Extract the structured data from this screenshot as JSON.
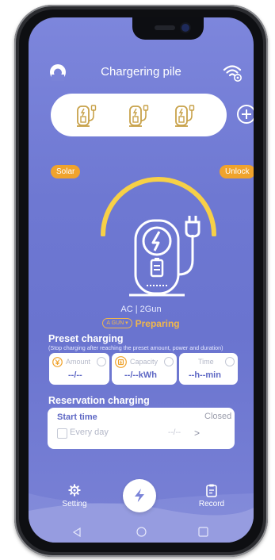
{
  "header": {
    "title": "Chargering pile"
  },
  "badges": {
    "solar": "Solar",
    "unlock": "Unlock"
  },
  "charger": {
    "spec": "AC | 2Gun",
    "gun_select": "A GUN",
    "status": "Preparing"
  },
  "preset": {
    "title": "Preset charging",
    "note": "(Stop charging after reaching the preset amount, power and duration)",
    "cards": [
      {
        "label": "Amount",
        "value": "--/--"
      },
      {
        "label": "Capacity",
        "value": "--/--kWh"
      },
      {
        "label": "Time",
        "value": "--h--min"
      }
    ]
  },
  "reservation": {
    "title": "Reservation charging",
    "start_time": "Start time",
    "state": "Closed",
    "every_day": "Every day",
    "time_value": "--/--",
    "arrow": ">"
  },
  "bottom_nav": {
    "setting": "Setting",
    "start": "Start",
    "record": "Record"
  },
  "colors": {
    "accent_orange": "#f0a32c",
    "screen_blue": "#6e78d2",
    "value_blue": "#5d67c4"
  },
  "icons": [
    "user-icon",
    "wifi-settings-icon",
    "charging-gun-icon",
    "add-circle-icon",
    "charging-station-icon",
    "yen-icon",
    "capacity-icon",
    "check-icon",
    "gear-icon",
    "lightning-icon",
    "record-icon",
    "back-icon",
    "home-icon",
    "recents-icon"
  ]
}
